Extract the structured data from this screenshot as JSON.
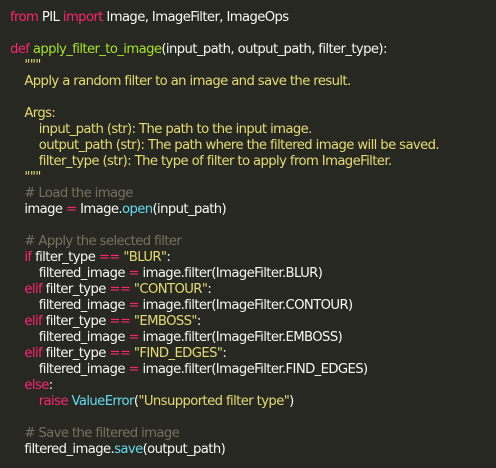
{
  "code": {
    "lines": [
      [
        {
          "t": "kw",
          "v": "from"
        },
        {
          "t": "",
          "v": " PIL "
        },
        {
          "t": "kw",
          "v": "import"
        },
        {
          "t": "",
          "v": " Image, ImageFilter, ImageOps"
        }
      ],
      [],
      [
        {
          "t": "kw",
          "v": "def"
        },
        {
          "t": "",
          "v": " "
        },
        {
          "t": "fn",
          "v": "apply_filter_to_image"
        },
        {
          "t": "",
          "v": "(input_path, output_path, filter_type):"
        }
      ],
      [
        {
          "t": "str",
          "v": "    \"\"\""
        }
      ],
      [
        {
          "t": "str",
          "v": "    Apply a random filter to an image and save the result."
        }
      ],
      [],
      [
        {
          "t": "str",
          "v": "    Args:"
        }
      ],
      [
        {
          "t": "str",
          "v": "        input_path (str): The path to the input image."
        }
      ],
      [
        {
          "t": "str",
          "v": "        output_path (str): The path where the filtered image will be saved."
        }
      ],
      [
        {
          "t": "str",
          "v": "        filter_type (str): The type of filter to apply from ImageFilter."
        }
      ],
      [
        {
          "t": "str",
          "v": "    \"\"\""
        }
      ],
      [
        {
          "t": "cm",
          "v": "    # Load the image"
        }
      ],
      [
        {
          "t": "",
          "v": "    image "
        },
        {
          "t": "op",
          "v": "="
        },
        {
          "t": "",
          "v": " Image."
        },
        {
          "t": "cls",
          "v": "open"
        },
        {
          "t": "",
          "v": "(input_path)"
        }
      ],
      [],
      [
        {
          "t": "cm",
          "v": "    # Apply the selected filter"
        }
      ],
      [
        {
          "t": "kw",
          "v": "    if"
        },
        {
          "t": "",
          "v": " filter_type "
        },
        {
          "t": "op",
          "v": "=="
        },
        {
          "t": "",
          "v": " "
        },
        {
          "t": "str",
          "v": "\"BLUR\""
        },
        {
          "t": "",
          "v": ":"
        }
      ],
      [
        {
          "t": "",
          "v": "        filtered_image "
        },
        {
          "t": "op",
          "v": "="
        },
        {
          "t": "",
          "v": " image.filter(ImageFilter.BLUR)"
        }
      ],
      [
        {
          "t": "kw",
          "v": "    elif"
        },
        {
          "t": "",
          "v": " filter_type "
        },
        {
          "t": "op",
          "v": "=="
        },
        {
          "t": "",
          "v": " "
        },
        {
          "t": "str",
          "v": "\"CONTOUR\""
        },
        {
          "t": "",
          "v": ":"
        }
      ],
      [
        {
          "t": "",
          "v": "        filtered_image "
        },
        {
          "t": "op",
          "v": "="
        },
        {
          "t": "",
          "v": " image.filter(ImageFilter.CONTOUR)"
        }
      ],
      [
        {
          "t": "kw",
          "v": "    elif"
        },
        {
          "t": "",
          "v": " filter_type "
        },
        {
          "t": "op",
          "v": "=="
        },
        {
          "t": "",
          "v": " "
        },
        {
          "t": "str",
          "v": "\"EMBOSS\""
        },
        {
          "t": "",
          "v": ":"
        }
      ],
      [
        {
          "t": "",
          "v": "        filtered_image "
        },
        {
          "t": "op",
          "v": "="
        },
        {
          "t": "",
          "v": " image.filter(ImageFilter.EMBOSS)"
        }
      ],
      [
        {
          "t": "kw",
          "v": "    elif"
        },
        {
          "t": "",
          "v": " filter_type "
        },
        {
          "t": "op",
          "v": "=="
        },
        {
          "t": "",
          "v": " "
        },
        {
          "t": "str",
          "v": "\"FIND_EDGES\""
        },
        {
          "t": "",
          "v": ":"
        }
      ],
      [
        {
          "t": "",
          "v": "        filtered_image "
        },
        {
          "t": "op",
          "v": "="
        },
        {
          "t": "",
          "v": " image.filter(ImageFilter.FIND_EDGES)"
        }
      ],
      [
        {
          "t": "kw",
          "v": "    else"
        },
        {
          "t": "",
          "v": ":"
        }
      ],
      [
        {
          "t": "kw",
          "v": "        raise"
        },
        {
          "t": "",
          "v": " "
        },
        {
          "t": "cls",
          "v": "ValueError"
        },
        {
          "t": "",
          "v": "("
        },
        {
          "t": "str",
          "v": "\"Unsupported filter type\""
        },
        {
          "t": "",
          "v": ")"
        }
      ],
      [],
      [
        {
          "t": "cm",
          "v": "    # Save the filtered image"
        }
      ],
      [
        {
          "t": "",
          "v": "    filtered_image."
        },
        {
          "t": "cls",
          "v": "save"
        },
        {
          "t": "",
          "v": "(output_path)"
        }
      ]
    ]
  },
  "theme": {
    "background": "#272822",
    "keyword": "#f92672",
    "function": "#a6e22e",
    "string": "#e6db74",
    "comment": "#75715e",
    "builtin": "#66d9ef",
    "text": "#f8f8f2"
  }
}
